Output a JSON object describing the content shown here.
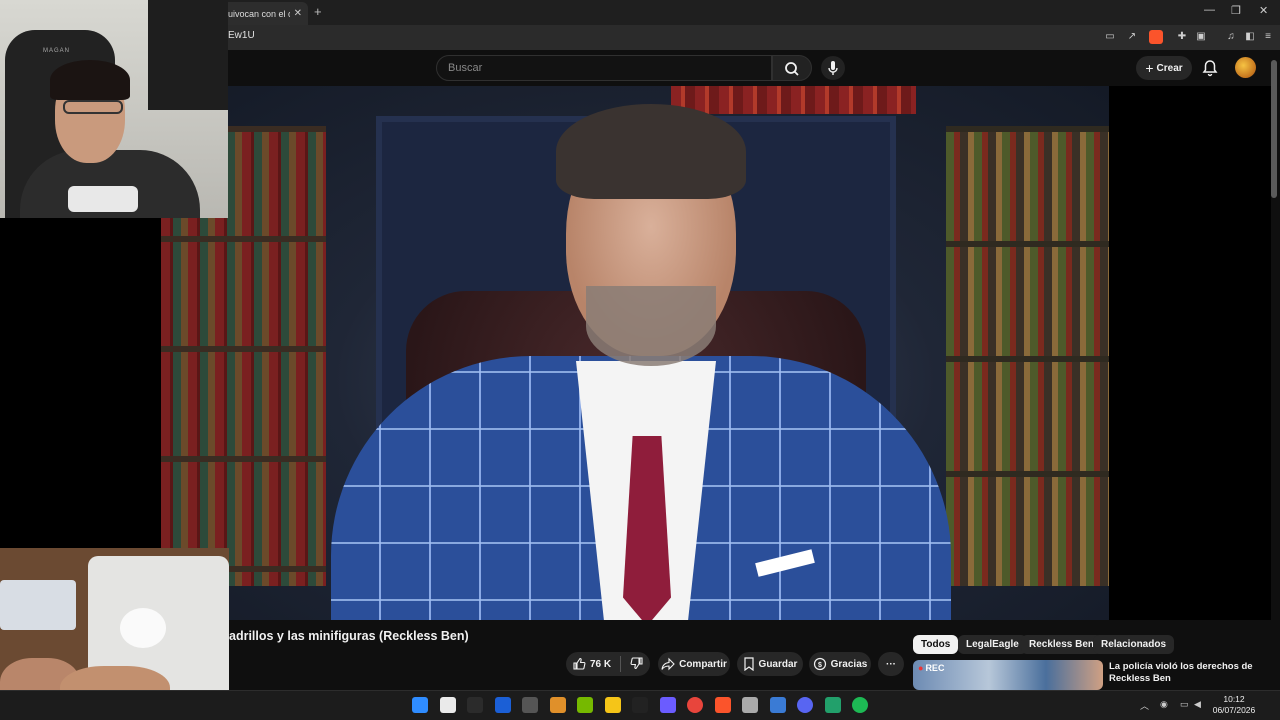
{
  "browser": {
    "tab_title": "uivocan con el ca",
    "tab_close": "✕",
    "new_tab": "+",
    "url": "Ew1U",
    "window_controls": [
      "—",
      "❐",
      "✕"
    ]
  },
  "youtube": {
    "search_placeholder": "Buscar",
    "create_label": "Crear",
    "icons": [
      "search-icon",
      "mic-icon",
      "plus-icon",
      "bell-icon"
    ]
  },
  "video": {
    "title": "adrillos y las minifiguras (Reckless Ben)",
    "actions": {
      "likes": "76 K",
      "share": "Compartir",
      "save": "Guardar",
      "thanks": "Gracias",
      "more": "···"
    }
  },
  "chips": [
    {
      "label": "Todos",
      "selected": true
    },
    {
      "label": "LegalEagle",
      "selected": false
    },
    {
      "label": "Reckless Ben",
      "selected": false
    },
    {
      "label": "Relacionados",
      "selected": false
    }
  ],
  "recommendation": {
    "badge": "REC",
    "title": "La policía violó los derechos de Reckless Ben"
  },
  "taskbar": {
    "time": "10:12",
    "date": "06/07/2026",
    "colors": [
      "#2f8cff",
      "#eaeaea",
      "#2b2b2b",
      "#1b5fd6",
      "#555",
      "#e0902a",
      "#76b900",
      "#f5c518",
      "#222",
      "#6b5cff",
      "#e8453c",
      "#fb542b",
      "#aaa",
      "#3a7bd5",
      "#5865f2",
      "#22a06b",
      "#1db954"
    ]
  },
  "overlay_text": {
    "cam_logo": "MAGAN"
  }
}
